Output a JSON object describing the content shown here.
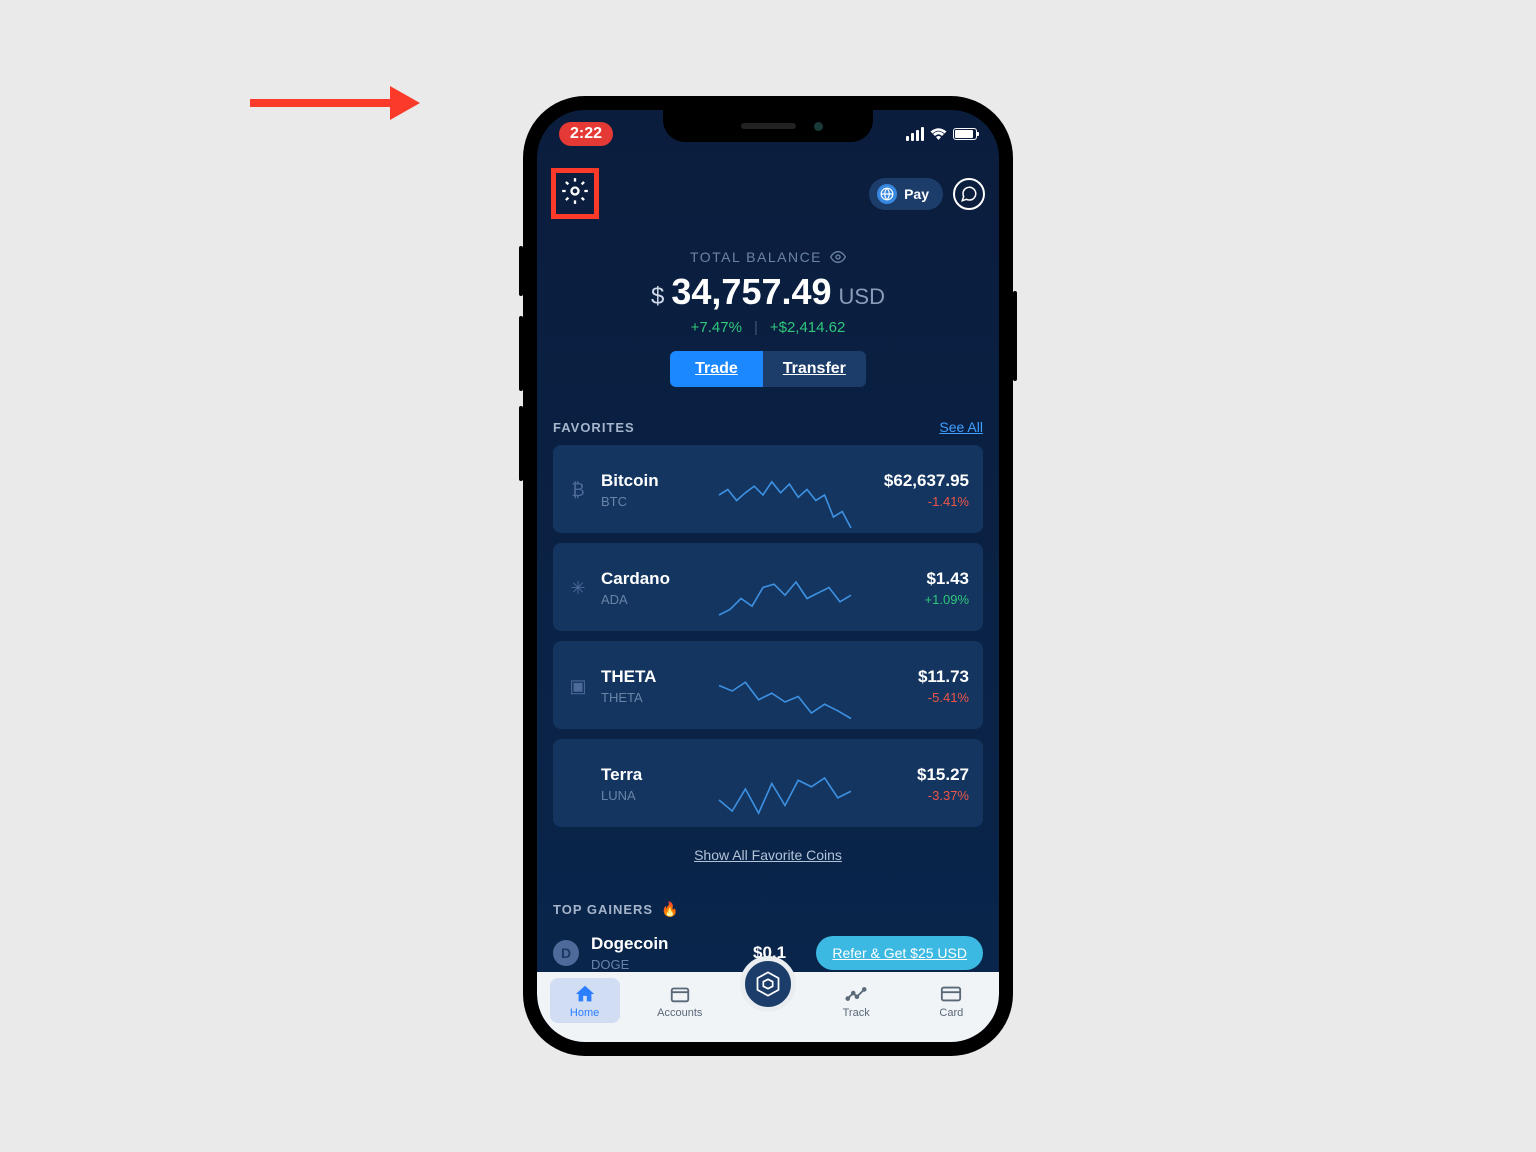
{
  "status_bar": {
    "time": "2:22"
  },
  "header": {
    "pay_label": "Pay"
  },
  "balance": {
    "label": "TOTAL BALANCE",
    "symbol": "$",
    "amount": "34,757.49",
    "currency": "USD",
    "pct_change": "+7.47%",
    "abs_change": "+$2,414.62",
    "trade_btn": "Trade",
    "transfer_btn": "Transfer"
  },
  "favorites": {
    "title": "FAVORITES",
    "see_all": "See All",
    "items": [
      {
        "name": "Bitcoin",
        "ticker": "BTC",
        "price": "$62,637.95",
        "change": "-1.41%",
        "direction": "red",
        "icon": "₿"
      },
      {
        "name": "Cardano",
        "ticker": "ADA",
        "price": "$1.43",
        "change": "+1.09%",
        "direction": "green",
        "icon": "✳"
      },
      {
        "name": "THETA",
        "ticker": "THETA",
        "price": "$11.73",
        "change": "-5.41%",
        "direction": "red",
        "icon": "▣"
      },
      {
        "name": "Terra",
        "ticker": "LUNA",
        "price": "$15.27",
        "change": "-3.37%",
        "direction": "red",
        "icon": ""
      }
    ],
    "show_all": "Show All Favorite Coins"
  },
  "top_gainers": {
    "title": "TOP GAINERS",
    "items": [
      {
        "name": "Dogecoin",
        "ticker": "DOGE",
        "price": "$0.1",
        "icon": "D"
      }
    ]
  },
  "refer_banner": "Refer & Get $25 USD",
  "nav": {
    "home": "Home",
    "accounts": "Accounts",
    "track": "Track",
    "card": "Card"
  }
}
